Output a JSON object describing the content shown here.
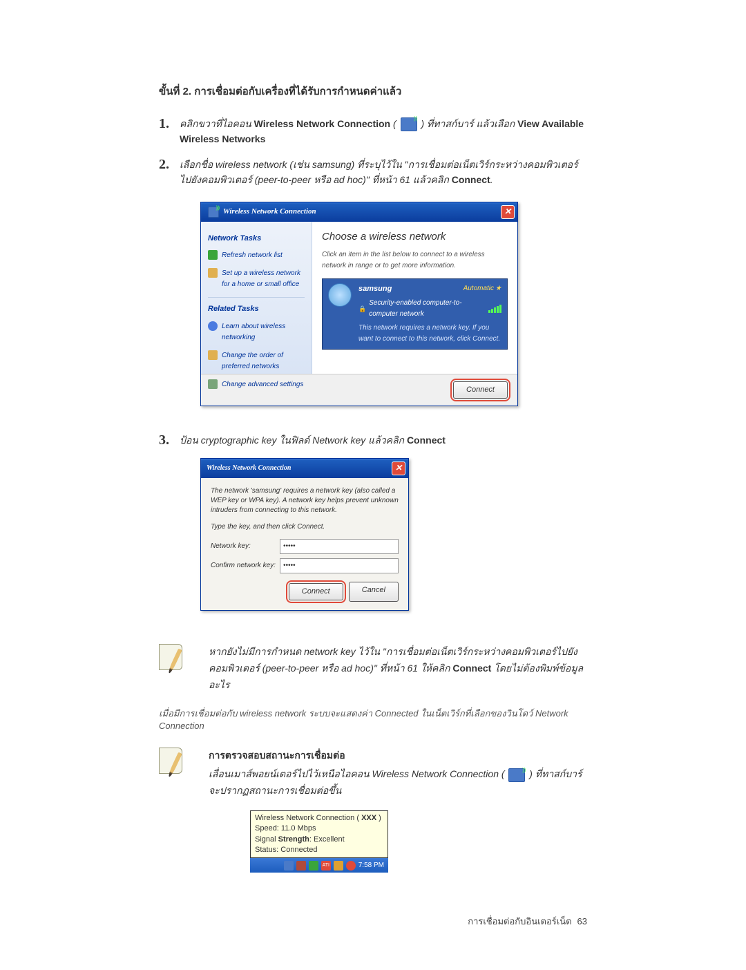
{
  "title": "ขั้นที่ 2. การเชื่อมต่อกับเครื่องที่ได้รับการกำหนดค่าแล้ว",
  "step1": {
    "pre": "คลิกขวาที่ไอคอน ",
    "bold1": "Wireless Network Connection",
    "mid": " ( ",
    "mid2": " ) ที่ทาสก์บาร์ แล้วเลือก ",
    "bold2": "View Available Wireless Networks"
  },
  "step2": {
    "pre": "เลือกชื่อ wireless network (เช่น samsung) ที่ระบุไว้ใน \"การเชื่อมต่อเน็ตเวิร์กระหว่างคอมพิวเตอร์ไปยังคอมพิวเตอร์ (peer-to-peer หรือ ad hoc)\" ที่หน้า 61 แล้วคลิก ",
    "bold1": "Connect"
  },
  "wnc": {
    "title": "Wireless Network Connection",
    "sidebar": {
      "section1": "Network Tasks",
      "link1": "Refresh network list",
      "link2": "Set up a wireless network for a home or small office",
      "section2": "Related Tasks",
      "link3": "Learn about wireless networking",
      "link4": "Change the order of preferred networks",
      "link5": "Change advanced settings"
    },
    "main": {
      "heading": "Choose a wireless network",
      "sub": "Click an item in the list below to connect to a wireless network in range or to get more information.",
      "net_name": "samsung",
      "net_auto": "Automatic",
      "net_sec": "Security-enabled computer-to-computer network",
      "net_desc": "This network requires a network key. If you want to connect to this network, click Connect."
    },
    "connect": "Connect"
  },
  "step3": {
    "pre": "ป้อน cryptographic key ในฟิลด์ Network key แล้วคลิก ",
    "bold1": "Connect"
  },
  "dialog": {
    "title": "Wireless Network Connection",
    "desc1": "The network 'samsung' requires a network key (also called a WEP key or WPA key). A network key helps prevent unknown intruders from connecting to this network.",
    "desc2": "Type the key, and then click Connect.",
    "label1": "Network key:",
    "label2": "Confirm network key:",
    "value": "•••••",
    "connect": "Connect",
    "cancel": "Cancel"
  },
  "note1": {
    "text_pre": "หากยังไม่มีการกำหนด network key ไว้ใน \"การเชื่อมต่อเน็ตเวิร์กระหว่างคอมพิวเตอร์ไปยังคอมพิวเตอร์ (peer-to-peer หรือ ad hoc)\" ที่หน้า 61 ให้คลิก ",
    "bold": "Connect",
    "text_post": " โดยไม่ต้องพิมพ์ข้อมูลอะไร"
  },
  "status_line": "เมื่อมีการเชื่อมต่อกับ wireless network ระบบจะแสดงค่า Connected ในเน็ตเวิร์กที่เลือกของวินโดว์ Network Connection",
  "note2": {
    "heading": "การตรวจสอบสถานะการเชื่อมต่อ",
    "text_pre": "เลื่อนเมาส์พอยน์เตอร์ไปไว้เหนือไอคอน Wireless Network Connection ( ",
    "text_post": " ) ที่ทาสก์บาร์ จะปรากฏสถานะการเชื่อมต่อขึ้น"
  },
  "tooltip": {
    "l1_pre": "Wireless Network Connection ( ",
    "l1_bold": "XXX",
    "l1_post": " )",
    "l2": "Speed: 11.0 Mbps",
    "l3_pre": "Signal ",
    "l3_bold": "Strength",
    "l3_post": ": Excellent",
    "l4_pre": "Status: ",
    "l4_val": "Connected",
    "time": "7:58 PM"
  },
  "footer": {
    "label": "การเชื่อมต่อกับอินเตอร์เน็ต",
    "page": "63"
  }
}
